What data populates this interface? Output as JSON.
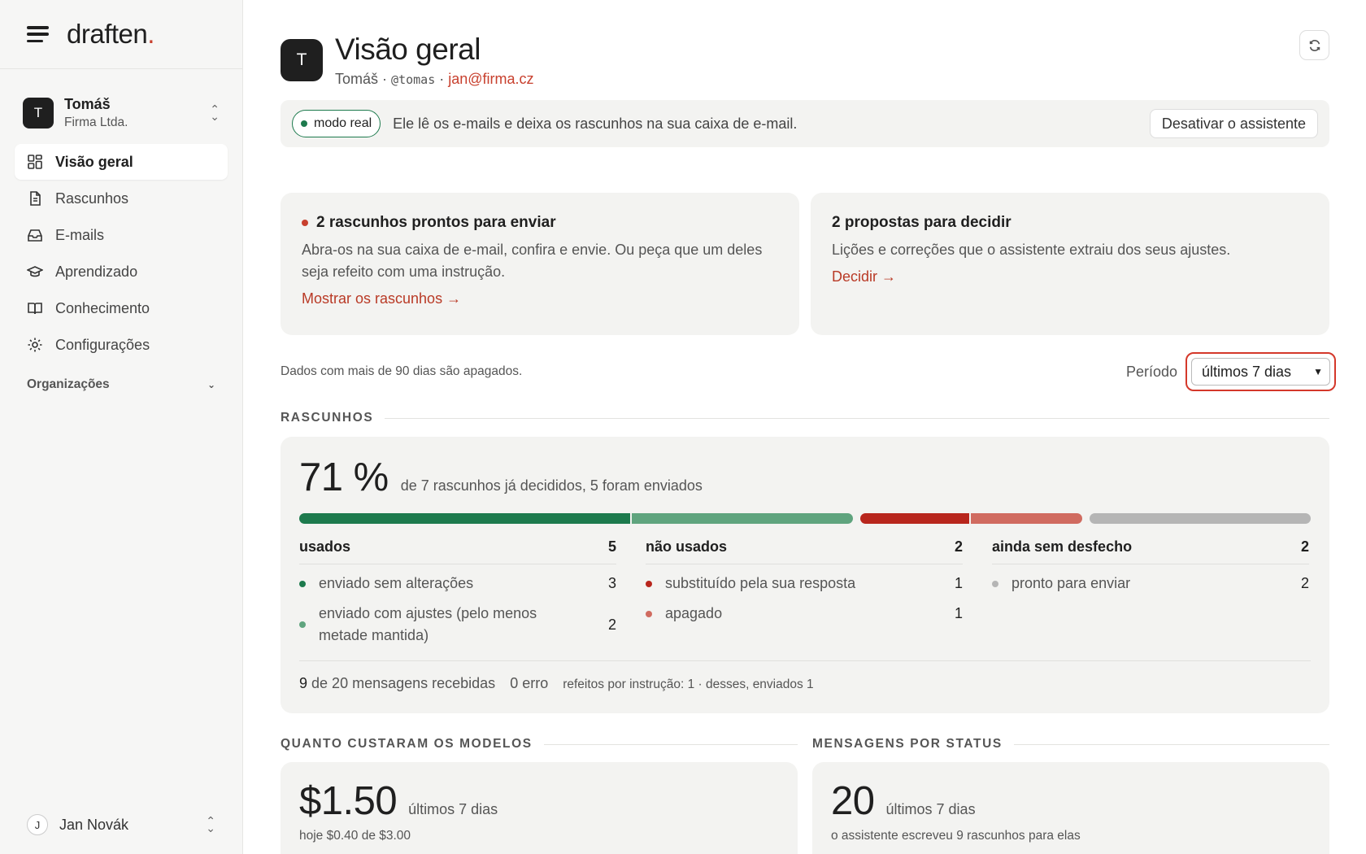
{
  "brand": {
    "name": "draften",
    "dot": "."
  },
  "workspace": {
    "initial": "T",
    "name": "Tomáš",
    "org": "Firma Ltda."
  },
  "nav": {
    "items": [
      {
        "label": "Visão geral"
      },
      {
        "label": "Rascunhos"
      },
      {
        "label": "E-mails"
      },
      {
        "label": "Aprendizado"
      },
      {
        "label": "Conhecimento"
      },
      {
        "label": "Configurações"
      }
    ],
    "section": "Organizações"
  },
  "user": {
    "initial": "J",
    "name": "Jan Novák"
  },
  "header": {
    "initial": "T",
    "title": "Visão geral",
    "name": "Tomáš",
    "handle": "@tomas",
    "email": "jan@firma.cz",
    "separator": "·"
  },
  "banner": {
    "mode": "modo real",
    "text": "Ele lê os e-mails e deixa os rascunhos na sua caixa de e-mail.",
    "button": "Desativar o assistente"
  },
  "cards": {
    "ready": {
      "title": "2 rascunhos prontos para enviar",
      "body": "Abra-os na sua caixa de e-mail, confira e envie. Ou peça que um deles seja refeito com uma instrução.",
      "link": "Mostrar os rascunhos →"
    },
    "proposals": {
      "title": "2 propostas para decidir",
      "body": "Lições e correções que o assistente extraiu dos seus ajustes.",
      "link": "Decidir →"
    }
  },
  "period": {
    "retention": "Dados com mais de 90 dias são apagados.",
    "label": "Período",
    "selected": "últimos 7 dias"
  },
  "drafts": {
    "section_title": "RASCUNHOS",
    "percent": "71 %",
    "summary": "de 7 rascunhos já decididos, 5 foram enviados",
    "bar": [
      {
        "status": "enviado sem alterações",
        "value": 3,
        "color": "#1d7a4d"
      },
      {
        "status": "enviado com ajustes",
        "value": 2,
        "color": "#5fa47e"
      },
      {
        "status": "substituído pela sua resposta",
        "value": 1,
        "color": "#b8261d"
      },
      {
        "status": "apagado",
        "value": 1,
        "color": "#d06b60"
      },
      {
        "status": "pronto para enviar",
        "value": 2,
        "color": "#b5b5b5"
      }
    ],
    "columns": [
      {
        "title": "usados",
        "count": "5",
        "items": [
          {
            "label": "enviado sem alterações",
            "count": "3",
            "color": "#1d7a4d"
          },
          {
            "label": "enviado com ajustes (pelo menos metade mantida)",
            "count": "2",
            "color": "#5fa47e"
          }
        ]
      },
      {
        "title": "não usados",
        "count": "2",
        "items": [
          {
            "label": "substituído pela sua resposta",
            "count": "1",
            "color": "#b8261d"
          },
          {
            "label": "apagado",
            "count": "1",
            "color": "#d06b60"
          }
        ]
      },
      {
        "title": "ainda sem desfecho",
        "count": "2",
        "items": [
          {
            "label": "pronto para enviar",
            "count": "2",
            "color": "#b5b5b5"
          }
        ]
      }
    ],
    "footer": {
      "received_count": "9",
      "received_text": "de 20 mensagens recebidas",
      "errors": "0 erro",
      "redone": "refeitos por instrução: 1 · desses, enviados 1"
    }
  },
  "cost": {
    "section_title": "QUANTO CUSTARAM OS MODELOS",
    "value": "$1.50",
    "period": "últimos 7 dias",
    "sub": "hoje $0.40 de $3.00"
  },
  "status": {
    "section_title": "MENSAGENS POR STATUS",
    "value": "20",
    "period": "últimos 7 dias",
    "sub": "o assistente escreveu 9 rascunhos para elas"
  }
}
